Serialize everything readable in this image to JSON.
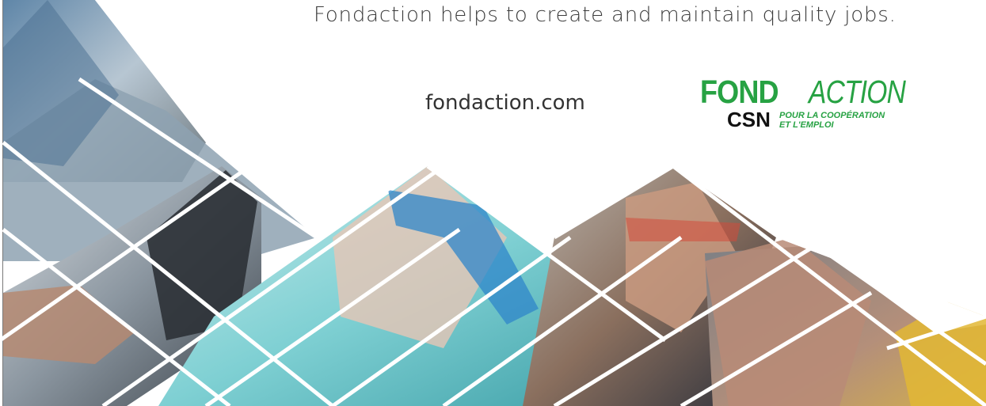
{
  "tagline": "Fondaction helps to create and maintain quality jobs.",
  "website": "fondaction.com",
  "logo": {
    "word_fond": "FOND",
    "word_action": "ACTION",
    "csn": "CSN",
    "tag_line1": "POUR LA COOPÉRATION",
    "tag_line2": "ET L'EMPLOI"
  },
  "colors": {
    "brand_green": "#27a243",
    "text": "#3c3c3c"
  }
}
